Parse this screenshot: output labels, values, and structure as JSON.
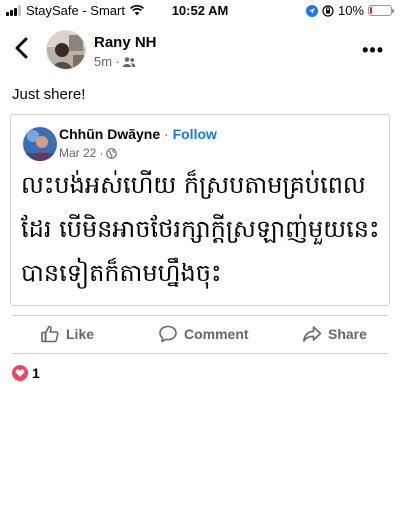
{
  "status_bar": {
    "carrier": "StaySafe - Smart",
    "time": "10:52 AM",
    "battery": "10%",
    "battery_level": 0.1,
    "icons": [
      "signal-icon",
      "wifi-icon",
      "location-icon",
      "orientation-lock-icon",
      "battery-icon"
    ]
  },
  "post": {
    "author": "Rany NH",
    "time": "5m",
    "separator": "·",
    "audience_icon": "friends-icon",
    "text": "Just shere!"
  },
  "shared_post": {
    "author": "Chhũn Dwãyne",
    "separator": "·",
    "follow_label": "Follow",
    "date": "Mar 22",
    "audience_icon": "globe-icon",
    "lines": [
      "លះបង់អស់ហើយ ក៏ស្របតាមគ្រប់ពេល",
      "ដែរ បើមិនអាចថែរក្សាក្ដីស្រឡាញ់មួយនេះ",
      "បានទៀតក៏តាមហ្នឹងចុះ"
    ]
  },
  "actions": {
    "like": "Like",
    "comment": "Comment",
    "share": "Share"
  },
  "reactions": {
    "count": "1",
    "icon": "heart-icon"
  },
  "colors": {
    "accent": "#1877f2",
    "heart": "#f3425f",
    "secondary_text": "#65676b"
  }
}
